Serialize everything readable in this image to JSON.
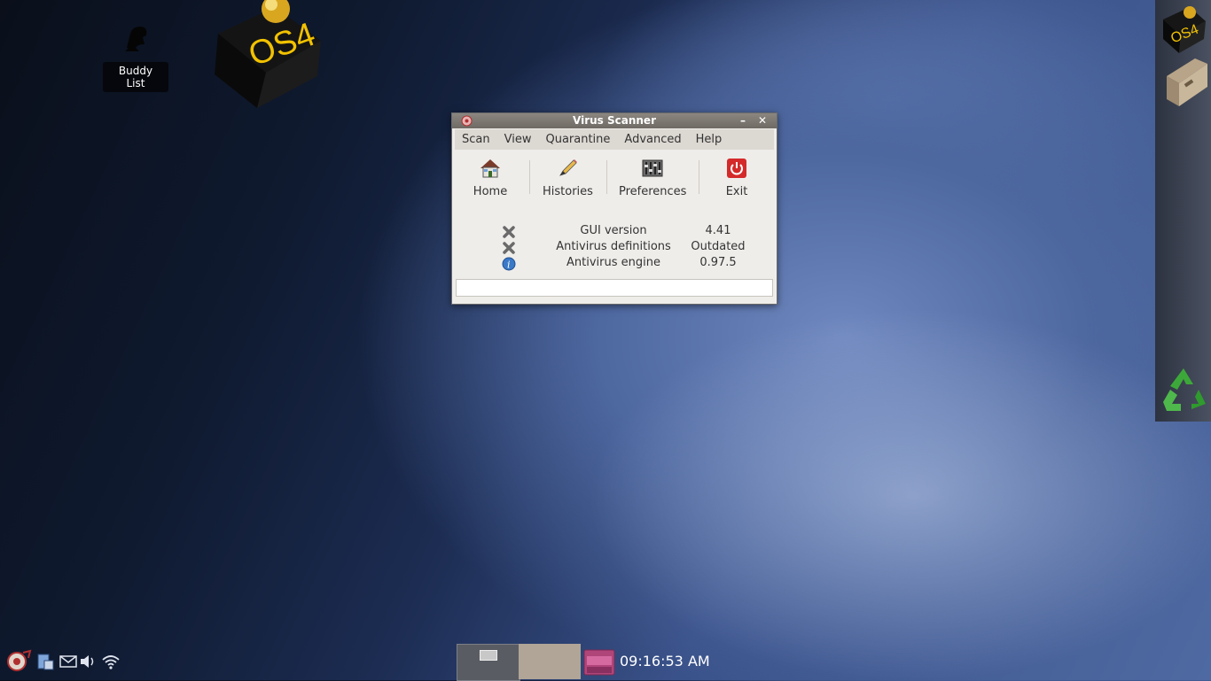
{
  "desktop": {
    "icons": [
      {
        "label": "Buddy List"
      }
    ],
    "logo_text": "OS4"
  },
  "window": {
    "title": "Virus Scanner",
    "minimize_label": "–",
    "close_label": "✕",
    "menu": [
      "Scan",
      "View",
      "Quarantine",
      "Advanced",
      "Help"
    ],
    "toolbar": [
      {
        "label": "Home",
        "icon": "home-icon"
      },
      {
        "label": "Histories",
        "icon": "pencil-icon"
      },
      {
        "label": "Preferences",
        "icon": "sliders-icon"
      },
      {
        "label": "Exit",
        "icon": "power-icon"
      }
    ],
    "status": [
      {
        "icon": "x-mark-icon",
        "name": "GUI version",
        "value": "4.41"
      },
      {
        "icon": "x-mark-icon",
        "name": "Antivirus definitions",
        "value": "Outdated"
      },
      {
        "icon": "info-icon",
        "name": "Antivirus engine",
        "value": "0.97.5"
      }
    ],
    "progress": 0
  },
  "dock": {
    "items": [
      "os4-logo-icon",
      "files-icon",
      "recycle-bin-icon"
    ]
  },
  "tray": {
    "icons": [
      "network-manager-icon",
      "clipboard-icon",
      "mail-icon",
      "volume-icon",
      "wifi-icon"
    ]
  },
  "taskbar": {
    "clock": "09:16:53 AM"
  },
  "colors": {
    "title_bar": "#7a756f",
    "window_bg": "#efedea",
    "logo_text": "#f2c200"
  }
}
